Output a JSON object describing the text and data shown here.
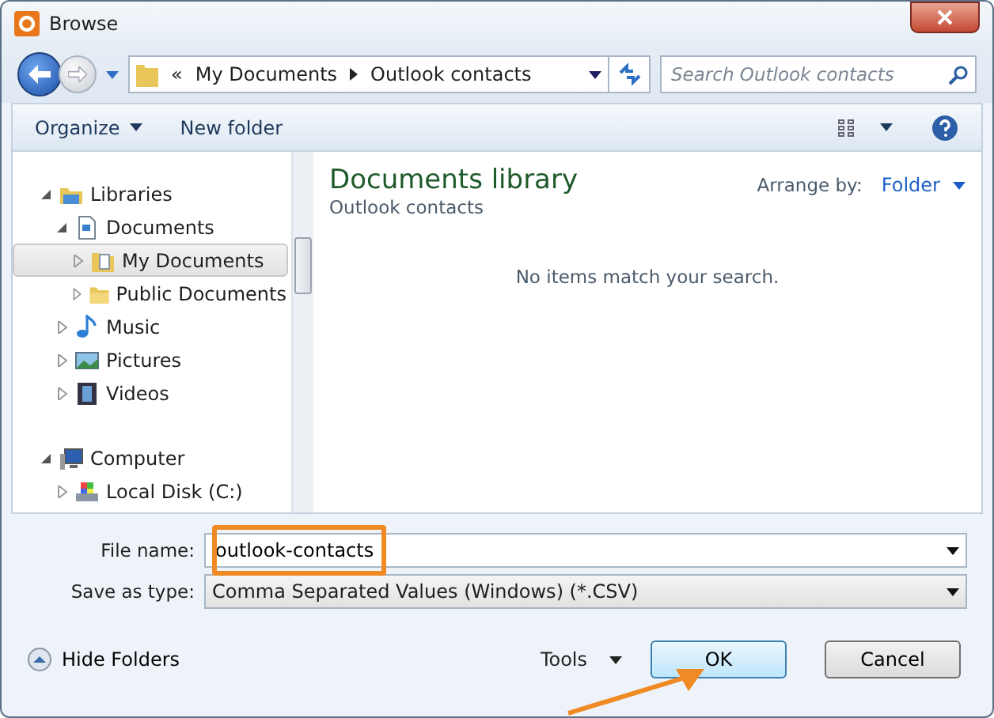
{
  "window": {
    "title": "Browse"
  },
  "address": {
    "overflow": "«",
    "crumbs": [
      "My Documents",
      "Outlook contacts"
    ]
  },
  "search": {
    "placeholder": "Search Outlook contacts"
  },
  "toolbar": {
    "organize": "Organize",
    "new_folder": "New folder"
  },
  "tree": [
    {
      "label": "Libraries",
      "kind": "library",
      "expanded": true,
      "selected": false,
      "children": [
        {
          "label": "Documents",
          "kind": "document",
          "expanded": true,
          "selected": false,
          "children": [
            {
              "label": "My Documents",
              "kind": "docfolder",
              "expanded": false,
              "selected": true
            },
            {
              "label": "Public Documents",
              "kind": "folder",
              "expanded": false,
              "selected": false
            }
          ]
        },
        {
          "label": "Music",
          "kind": "music",
          "expanded": false,
          "selected": false
        },
        {
          "label": "Pictures",
          "kind": "pictures",
          "expanded": false,
          "selected": false
        },
        {
          "label": "Videos",
          "kind": "videos",
          "expanded": false,
          "selected": false
        }
      ]
    },
    {
      "label": "Computer",
      "kind": "computer",
      "expanded": true,
      "selected": false,
      "children": [
        {
          "label": "Local Disk (C:)",
          "kind": "disk",
          "expanded": false,
          "selected": false
        }
      ]
    }
  ],
  "library": {
    "title": "Documents library",
    "subtitle": "Outlook contacts",
    "arrange_label": "Arrange by:",
    "arrange_value": "Folder",
    "empty": "No items match your search."
  },
  "form": {
    "file_name_label": "File name:",
    "file_name": "outlook-contacts",
    "type_label": "Save as type:",
    "type_value": "Comma Separated Values (Windows) (*.CSV)"
  },
  "footer": {
    "hide_folders": "Hide Folders",
    "tools": "Tools",
    "ok": "OK",
    "cancel": "Cancel"
  }
}
